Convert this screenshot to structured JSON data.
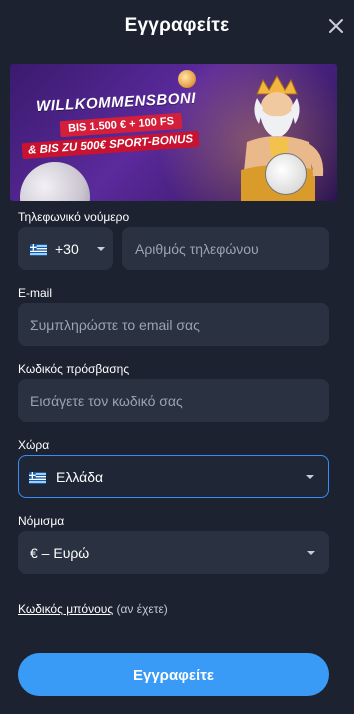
{
  "header": {
    "title": "Εγγραφείτε"
  },
  "banner": {
    "line1": "WILLKOMMENSBONI",
    "line2": "BIS 1.500 € + 100 FS",
    "line3": "& BIS ZU 500€ SPORT-BONUS"
  },
  "phone": {
    "label": "Τηλεφωνικό νούμερο",
    "country_code": "+30",
    "placeholder": "Αριθμός τηλεφώνου",
    "flag_icon": "greece-flag-icon"
  },
  "email": {
    "label": "E-mail",
    "placeholder": "Συμπληρώστε το email σας"
  },
  "password": {
    "label": "Κωδικός πρόσβασης",
    "placeholder": "Εισάγετε τον κωδικό σας"
  },
  "country": {
    "label": "Χώρα",
    "value": "Ελλάδα",
    "flag_icon": "greece-flag-icon"
  },
  "currency": {
    "label": "Νόμισμα",
    "value": "€ – Ευρώ"
  },
  "bonus_code": {
    "link_text": "Κωδικός μπόνους",
    "suffix": "(αν έχετε)"
  },
  "submit": {
    "label": "Εγγραφείτε"
  },
  "colors": {
    "background": "#1c2230",
    "field": "#2a3140",
    "accent": "#3a9bf7",
    "focus_border": "#3a8df5"
  }
}
